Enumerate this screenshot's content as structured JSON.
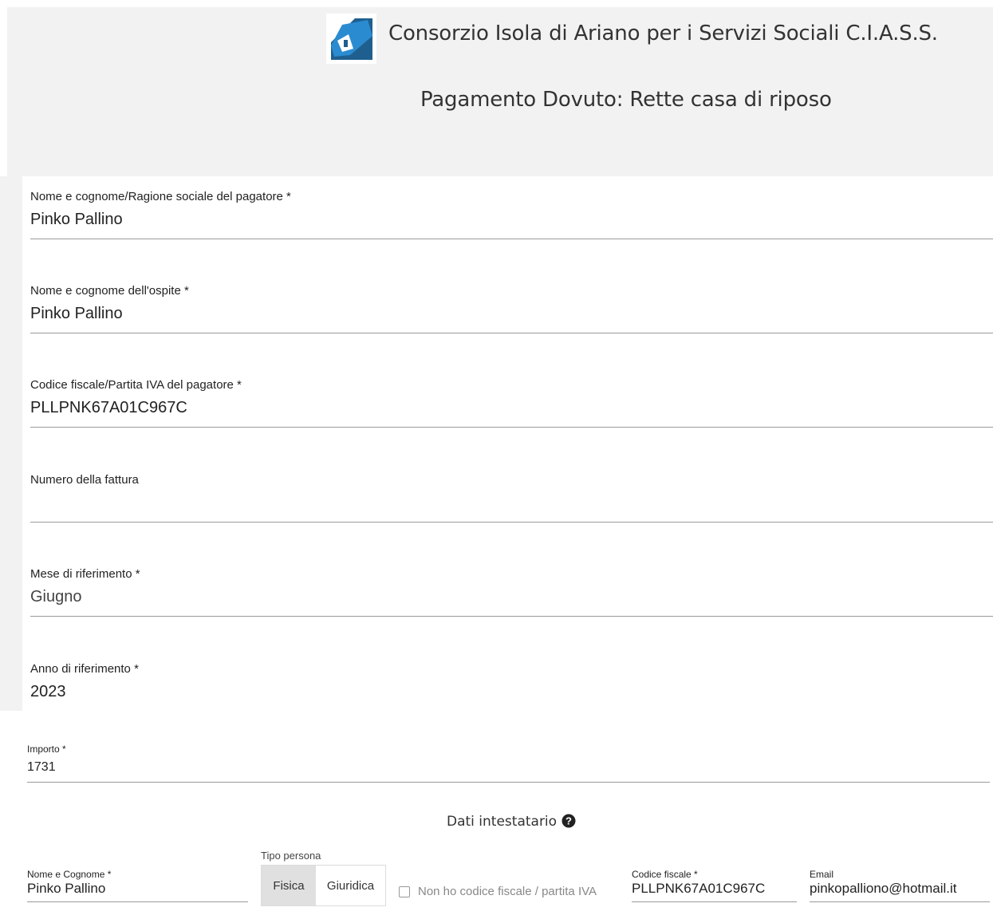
{
  "header": {
    "org_name": "Consorzio Isola di Ariano per i Servizi Sociali C.I.A.S.S.",
    "page_title": "Pagamento Dovuto: Rette casa di riposo",
    "logo_icon": "house-logo-icon",
    "colors": {
      "logo_blue": "#2a8bd0",
      "logo_dark": "#1f5f8f",
      "header_bg": "#f2f2f2"
    }
  },
  "form": {
    "fields": [
      {
        "label": "Nome e cognome/Ragione sociale del pagatore *",
        "value": "Pinko Pallino"
      },
      {
        "label": "Nome e cognome dell'ospite *",
        "value": "Pinko Pallino"
      },
      {
        "label": "Codice fiscale/Partita IVA del pagatore *",
        "value": "PLLPNK67A01C967C"
      },
      {
        "label": "Numero della fattura",
        "value": ""
      },
      {
        "label": "Mese di riferimento *",
        "value": "Giugno"
      },
      {
        "label": "Anno di riferimento *",
        "value": "2023"
      }
    ],
    "importo": {
      "label": "Importo *",
      "value": "1731"
    }
  },
  "intestatario": {
    "title": "Dati intestatario",
    "help_icon": "question-circle-icon",
    "nome": {
      "label": "Nome e Cognome *",
      "value": "Pinko Pallino"
    },
    "tipo_persona": {
      "label": "Tipo persona",
      "options": [
        "Fisica",
        "Giuridica"
      ],
      "selected": "Fisica"
    },
    "no_cf": {
      "label": "Non ho codice fiscale / partita IVA",
      "checked": false
    },
    "codice_fiscale": {
      "label": "Codice fiscale *",
      "value": "PLLPNK67A01C967C"
    },
    "email": {
      "label": "Email",
      "value": "pinkopalliono@hotmail.it"
    }
  }
}
